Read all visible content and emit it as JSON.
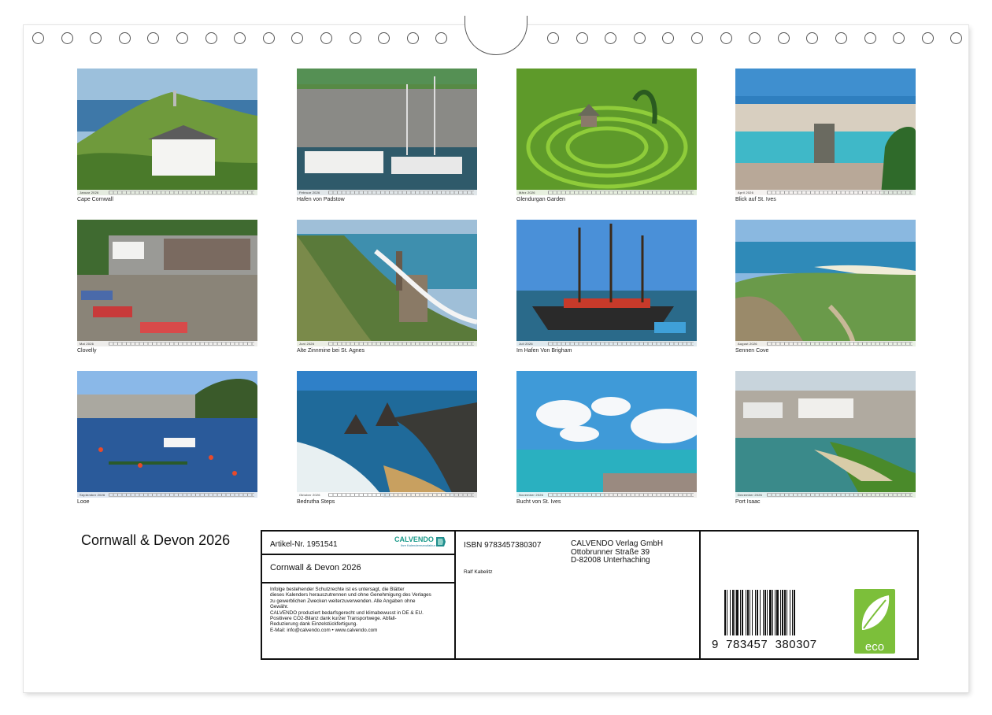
{
  "calendar_title": "Cornwall & Devon 2026",
  "photos": [
    {
      "caption": "Cape Cornwall",
      "month": "Januar 2026"
    },
    {
      "caption": "Hafen von Padstow",
      "month": "Februar 2026"
    },
    {
      "caption": "Glendurgan Garden",
      "month": "März 2026"
    },
    {
      "caption": "Blick auf St. Ives",
      "month": "April 2026"
    },
    {
      "caption": "Clovelly",
      "month": "Mai 2026"
    },
    {
      "caption": "Alte Zinnmine bei St. Agnes",
      "month": "Juni 2026"
    },
    {
      "caption": "Im Hafen Von Brigham",
      "month": "Juli 2026"
    },
    {
      "caption": "Sennen Cove",
      "month": "August 2026"
    },
    {
      "caption": "Looe",
      "month": "September 2026"
    },
    {
      "caption": "Bedrutha Steps",
      "month": "Oktober 2026"
    },
    {
      "caption": "Bucht von St. Ives",
      "month": "November 2026"
    },
    {
      "caption": "Port Isaac",
      "month": "Dezember 2026"
    }
  ],
  "info": {
    "article_no": "Artikel-Nr. 1951541",
    "brand": "CALVENDO",
    "brand_tagline": "Ihre Kalendermanufaktur",
    "title": "Cornwall & Devon 2026",
    "legal": [
      "Infolge bestehender Schutzrechte ist es untersagt, die Blätter",
      "dieses Kalenders herauszutrennen und ohne Genehmigung des Verlages",
      "zu gewerblichen Zwecken weiterzuverwenden. Alle Angaben ohne",
      "Gewähr.",
      "CALVENDO produziert bedarfsgerecht und klimabewusst in DE & EU.",
      "Positivere CO2-Bilanz dank kurzer Transportwege. Abfall-",
      "Reduzierung dank Einzelstückfertigung.",
      "E-Mail: info@calvendo.com • www.calvendo.com"
    ],
    "isbn": "ISBN 9783457380307",
    "author": "Ralf Kabelitz",
    "publisher": [
      "CALVENDO Verlag GmbH",
      "Ottobrunner Straße 39",
      "D-82008 Unterhaching"
    ],
    "barcode_digits": "9  783457  380307",
    "eco_label": "eco"
  }
}
